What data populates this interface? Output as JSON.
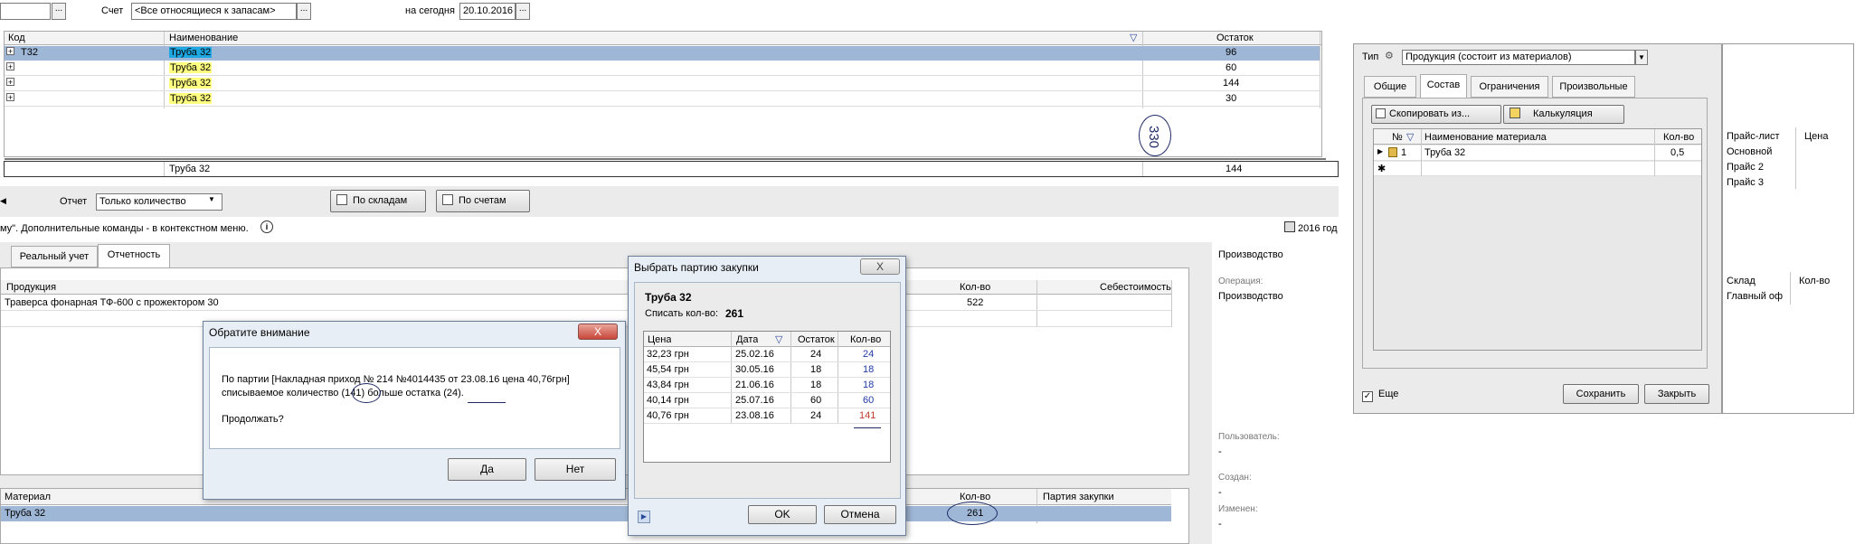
{
  "filters": {
    "account_label": "Счет",
    "account_value": "<Все относящиеся к запасам>",
    "date_label": "на сегодня",
    "date_value": "20.10.2016",
    "dots": "..."
  },
  "top_grid": {
    "col_code": "Код",
    "col_name": "Наименование",
    "col_rest": "Остаток",
    "rows": [
      {
        "expander": "+",
        "code": "T32",
        "name": "Труба 32",
        "rest": "96"
      },
      {
        "expander": "+",
        "code": "",
        "name": "Труба 32",
        "rest": "60"
      },
      {
        "expander": "+",
        "code": "",
        "name": "Труба 32",
        "rest": "144"
      },
      {
        "expander": "+",
        "code": "",
        "name": "Труба 32",
        "rest": "30"
      }
    ],
    "footer_name": "Труба 32",
    "footer_rest": "144",
    "annotation": "330"
  },
  "report": {
    "report_label": "Отчет",
    "report_value": "Только количество",
    "by_warehouses": "По складам",
    "by_accounts": "По счетам"
  },
  "hint_bar": {
    "text": "му\". Дополнительные команды - в контекстном меню.",
    "year": "2016 год"
  },
  "left_tabs": [
    "Реальный учет",
    "Отчетность"
  ],
  "products_grid": {
    "col_product": "Продукция",
    "col_qty": "Кол-во",
    "col_cost": "Себестоимость",
    "row_product": "Траверса фонарная ТФ-600 с прожектором 30",
    "row_qty": "522"
  },
  "materials_grid": {
    "col_material": "Материал",
    "col_qty": "Кол-во",
    "col_batch": "Партия закупки",
    "row_material": "Труба 32",
    "row_qty": "261"
  },
  "info_panel": {
    "type_value": "Производство",
    "operation_label": "Операция:",
    "operation_value": "Производство",
    "user_label": "Пользователь:",
    "user_value": "-",
    "created_label": "Создан:",
    "created_value": "-",
    "changed_label": "Изменен:",
    "changed_value": "-"
  },
  "attention_dialog": {
    "title": "Обратите внимание",
    "close": "X",
    "line1": "По партии [Накладная приход № 214 №4014435 от 23.08.16 цена 40,76грн]",
    "line2_pre": "списываемое количество",
    "qty": "(141)",
    "line2_mid": "больше остатка",
    "rest": "(24).",
    "question": "Продолжать?",
    "yes": "Да",
    "no": "Нет"
  },
  "batch_dialog": {
    "title": "Выбрать партию закупки",
    "close": "X",
    "material": "Труба 32",
    "writeoff_label": "Списать кол-во:",
    "writeoff_value": "261",
    "columns": [
      "Цена",
      "Дата",
      "Остаток",
      "Кол-во"
    ],
    "rows": [
      {
        "price": "32,23 грн",
        "date": "25.02.16",
        "rest": "24",
        "qty": "24"
      },
      {
        "price": "45,54 грн",
        "date": "30.05.16",
        "rest": "18",
        "qty": "18"
      },
      {
        "price": "43,84 грн",
        "date": "21.06.16",
        "rest": "18",
        "qty": "18"
      },
      {
        "price": "40,14 грн",
        "date": "25.07.16",
        "rest": "60",
        "qty": "60"
      },
      {
        "price": "40,76 грн",
        "date": "23.08.16",
        "rest": "24",
        "qty": "141"
      }
    ],
    "ok": "OK",
    "cancel": "Отмена"
  },
  "product_card": {
    "type_label": "Тип",
    "type_value": "Продукция (состоит из материалов)",
    "tabs": [
      "Общие",
      "Состав",
      "Ограничения",
      "Произвольные"
    ],
    "copy_from": "Скопировать из...",
    "calculation": "Калькуляция",
    "grid_cols": [
      "№",
      "Наименование материала",
      "Кол-во"
    ],
    "grid_row": {
      "num": "1",
      "name": "Труба 32",
      "qty": "0,5"
    },
    "new_row": "✱",
    "more": "Еще",
    "save": "Сохранить",
    "close": "Закрыть"
  },
  "price_panel": {
    "col_pricelist": "Прайс-лист",
    "col_price": "Цена",
    "prices": [
      "Основной",
      "Прайс 2",
      "Прайс 3"
    ],
    "col_warehouse": "Склад",
    "col_qty": "Кол-во",
    "warehouses": [
      "Главный оф"
    ]
  },
  "colors": {
    "selection": "#9fb7d6",
    "highlight_yellow": "#ffff80",
    "annotation_ink": "#1e2a66",
    "error_red": "#c0392b"
  }
}
